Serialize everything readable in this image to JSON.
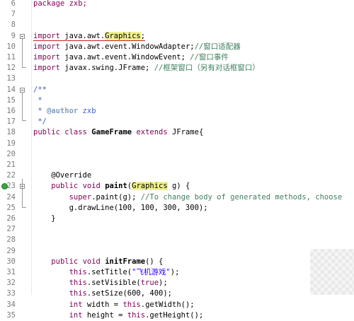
{
  "editor": {
    "lines": [
      {
        "number": "6",
        "tokens": [
          {
            "t": "package zxb;",
            "c": "kw-first"
          }
        ]
      },
      {
        "number": "7",
        "tokens": []
      },
      {
        "number": "8",
        "tokens": []
      },
      {
        "number": "9",
        "fold": "open",
        "tokens": [
          {
            "t": "import",
            "c": "kw under"
          },
          {
            "t": " java.awt.",
            "c": "under"
          },
          {
            "t": "Graphics",
            "c": "hl under"
          },
          {
            "t": ";",
            "c": "under"
          }
        ]
      },
      {
        "number": "10",
        "tokens": [
          {
            "t": "import",
            "c": "kw"
          },
          {
            "t": " java.awt.event.WindowAdapter;",
            "c": ""
          },
          {
            "t": "//窗口适配器",
            "c": "cm"
          }
        ]
      },
      {
        "number": "11",
        "tokens": [
          {
            "t": "import",
            "c": "kw"
          },
          {
            "t": " java.awt.event.WindowEvent; ",
            "c": ""
          },
          {
            "t": "//窗口事件",
            "c": "cm"
          }
        ]
      },
      {
        "number": "12",
        "tokens": [
          {
            "t": "import",
            "c": "kw"
          },
          {
            "t": " javax.swing.JFrame; ",
            "c": ""
          },
          {
            "t": "//框架窗口（另有对话框窗口）",
            "c": "cm"
          }
        ]
      },
      {
        "number": "13",
        "tokens": []
      },
      {
        "number": "14",
        "fold": "open",
        "tokens": [
          {
            "t": "/**",
            "c": "jd"
          }
        ]
      },
      {
        "number": "15",
        "tokens": [
          {
            "t": " *",
            "c": "jd"
          }
        ]
      },
      {
        "number": "16",
        "tokens": [
          {
            "t": " * ",
            "c": "jd"
          },
          {
            "t": "@author",
            "c": "tag"
          },
          {
            "t": " zxb",
            "c": "jd"
          }
        ]
      },
      {
        "number": "17",
        "tokens": [
          {
            "t": " */",
            "c": "jd"
          }
        ]
      },
      {
        "number": "18",
        "tokens": [
          {
            "t": "public",
            "c": "kw"
          },
          {
            "t": " ",
            "c": ""
          },
          {
            "t": "class",
            "c": "kw"
          },
          {
            "t": " ",
            "c": ""
          },
          {
            "t": "GameFrame",
            "c": "bold"
          },
          {
            "t": " ",
            "c": ""
          },
          {
            "t": "extends",
            "c": "kw"
          },
          {
            "t": " JFrame{",
            "c": ""
          }
        ]
      },
      {
        "number": "19",
        "tokens": []
      },
      {
        "number": "20",
        "tokens": []
      },
      {
        "number": "21",
        "tokens": []
      },
      {
        "number": "22",
        "tokens": [
          {
            "t": "    @Override",
            "c": ""
          }
        ]
      },
      {
        "number": "23",
        "marker": true,
        "fold": "open",
        "tokens": [
          {
            "t": "    ",
            "c": ""
          },
          {
            "t": "public",
            "c": "kw"
          },
          {
            "t": " ",
            "c": ""
          },
          {
            "t": "void",
            "c": "kw"
          },
          {
            "t": " ",
            "c": ""
          },
          {
            "t": "paint",
            "c": "bold"
          },
          {
            "t": "(",
            "c": ""
          },
          {
            "t": "Graphics",
            "c": "hl"
          },
          {
            "t": " g) {",
            "c": ""
          }
        ]
      },
      {
        "number": "24",
        "tokens": [
          {
            "t": "        ",
            "c": ""
          },
          {
            "t": "super",
            "c": "kw"
          },
          {
            "t": ".paint(g); ",
            "c": ""
          },
          {
            "t": "//To change body of generated methods, choose",
            "c": "cm"
          }
        ]
      },
      {
        "number": "25",
        "tokens": [
          {
            "t": "        g.drawLine(100, 100, 300, 300);",
            "c": ""
          }
        ]
      },
      {
        "number": "26",
        "tokens": [
          {
            "t": "    }",
            "c": ""
          }
        ]
      },
      {
        "number": "27",
        "tokens": []
      },
      {
        "number": "28",
        "tokens": []
      },
      {
        "number": "29",
        "tokens": []
      },
      {
        "number": "30",
        "tokens": [
          {
            "t": "    ",
            "c": ""
          },
          {
            "t": "public",
            "c": "kw"
          },
          {
            "t": " ",
            "c": ""
          },
          {
            "t": "void",
            "c": "kw"
          },
          {
            "t": " ",
            "c": ""
          },
          {
            "t": "initFrame",
            "c": "bold"
          },
          {
            "t": "() {",
            "c": ""
          }
        ]
      },
      {
        "number": "31",
        "tokens": [
          {
            "t": "        ",
            "c": ""
          },
          {
            "t": "this",
            "c": "kw"
          },
          {
            "t": ".setTitle(",
            "c": ""
          },
          {
            "t": "\"飞机游戏\"",
            "c": "str"
          },
          {
            "t": ");",
            "c": ""
          }
        ]
      },
      {
        "number": "32",
        "tokens": [
          {
            "t": "        ",
            "c": ""
          },
          {
            "t": "this",
            "c": "kw"
          },
          {
            "t": ".setVisible(",
            "c": ""
          },
          {
            "t": "true",
            "c": "kw"
          },
          {
            "t": ");",
            "c": ""
          }
        ]
      },
      {
        "number": "33",
        "tokens": [
          {
            "t": "        ",
            "c": ""
          },
          {
            "t": "this",
            "c": "kw"
          },
          {
            "t": ".setSize(600, 400);",
            "c": ""
          }
        ]
      },
      {
        "number": "34",
        "tokens": [
          {
            "t": "        ",
            "c": ""
          },
          {
            "t": "int",
            "c": "kw"
          },
          {
            "t": " width = ",
            "c": ""
          },
          {
            "t": "this",
            "c": "kw"
          },
          {
            "t": ".getWidth();",
            "c": ""
          }
        ]
      },
      {
        "number": "35",
        "tokens": [
          {
            "t": "        ",
            "c": ""
          },
          {
            "t": "int",
            "c": "kw"
          },
          {
            "t": " height = ",
            "c": ""
          },
          {
            "t": "this",
            "c": "kw"
          },
          {
            "t": ".getHeight();",
            "c": ""
          }
        ]
      }
    ]
  }
}
